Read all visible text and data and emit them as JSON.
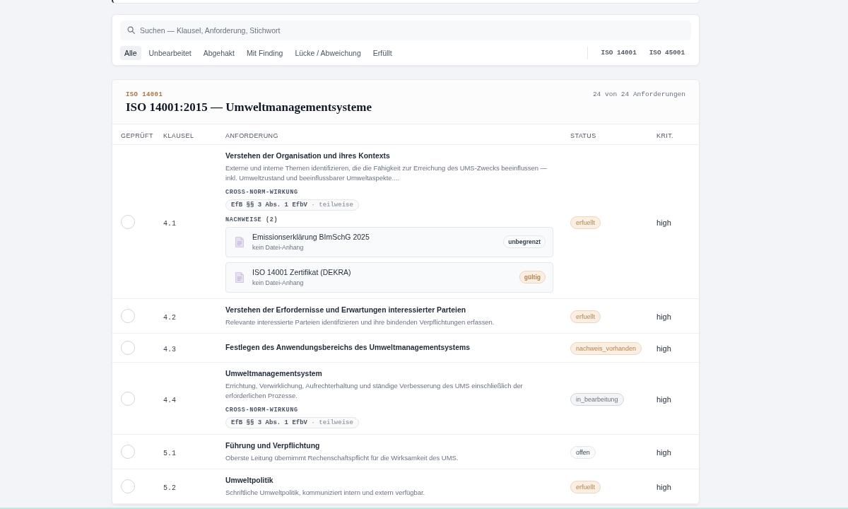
{
  "search": {
    "placeholder": "Suchen — Klausel, Anforderung, Stichwort"
  },
  "filters": [
    {
      "label": "Alle",
      "selected": true
    },
    {
      "label": "Unbearbeitet",
      "selected": false
    },
    {
      "label": "Abgehakt",
      "selected": false
    },
    {
      "label": "Mit Finding",
      "selected": false
    },
    {
      "label": "Lücke / Abweichung",
      "selected": false
    },
    {
      "label": "Erfüllt",
      "selected": false
    }
  ],
  "norm_filters": [
    {
      "label": "ISO 14001"
    },
    {
      "label": "ISO 45001"
    }
  ],
  "section": {
    "norm_tag": "ISO 14001",
    "title": "ISO 14001:2015 — Umweltmanagementsysteme",
    "count": "24 von 24 Anforderungen"
  },
  "table": {
    "columns": [
      "GEPRÜFT",
      "KLAUSEL",
      "ANFORDERUNG",
      "STATUS",
      "KRIT."
    ],
    "rows": [
      {
        "checked": false,
        "clause": "4.1",
        "title": "Verstehen der Organisation und ihres Kontexts",
        "description": "Externe und interne Themen identifizieren, die die Fähigkeit zur Erreichung des UMS-Zwecks beeinflussen — inkl. Umweltzustand und beeinflussbarer Umweltaspekte....",
        "cross_norm": {
          "label": "CROSS-NORM-WIRKUNG",
          "items": [
            {
              "norm": "EfB §§ 3 Abs. 1 EfbV",
              "separator": "·",
              "degree": "teilweise"
            }
          ]
        },
        "evidence": {
          "label": "NACHWEISE (2)",
          "items": [
            {
              "title": "Emissionserklärung BImSchG 2025",
              "note": "kein Datei-Anhang",
              "validity": {
                "label": "unbegrenzt",
                "kind": "plain"
              }
            },
            {
              "title": "ISO 14001 Zertifikat (DEKRA)",
              "note": "kein Datei-Anhang",
              "validity": {
                "label": "gültig",
                "kind": "positive"
              }
            }
          ]
        },
        "status": {
          "label": "erfuellt",
          "kind": "positive"
        },
        "criticality": "high"
      },
      {
        "checked": false,
        "clause": "4.2",
        "title": "Verstehen der Erfordernisse und Erwartungen interessierter Parteien",
        "description": "Relevante interessierte Parteien identifizieren und ihre bindenden Verpflichtungen erfassen.",
        "status": {
          "label": "erfuellt",
          "kind": "positive"
        },
        "criticality": "high"
      },
      {
        "checked": false,
        "clause": "4.3",
        "title": "Festlegen des Anwendungsbereichs des Umweltmanagementsystems",
        "status": {
          "label": "nachweis_vorhanden",
          "kind": "positive"
        },
        "criticality": "high"
      },
      {
        "checked": false,
        "clause": "4.4",
        "title": "Umweltmanagementsystem",
        "description": "Errichtung, Verwirklichung, Aufrechterhaltung und ständige Verbesserung des UMS einschließlich der erforderlichen Prozesse.",
        "cross_norm": {
          "label": "CROSS-NORM-WIRKUNG",
          "items": [
            {
              "norm": "EfB §§ 3 Abs. 1 EfbV",
              "separator": "·",
              "degree": "teilweise"
            }
          ]
        },
        "status": {
          "label": "in_bearbeitung",
          "kind": "progress"
        },
        "criticality": "high"
      },
      {
        "checked": false,
        "clause": "5.1",
        "title": "Führung und Verpflichtung",
        "description": "Oberste Leitung übernimmt Rechenschaftspflicht für die Wirksamkeit des UMS.",
        "status": {
          "label": "offen",
          "kind": "plain"
        },
        "criticality": "high"
      },
      {
        "checked": false,
        "clause": "5.2",
        "title": "Umweltpolitik",
        "description": "Schriftliche Umweltpolitik, kommuniziert intern und extern verfügbar.",
        "status": {
          "label": "erfuellt",
          "kind": "positive"
        },
        "criticality": "high"
      }
    ]
  }
}
